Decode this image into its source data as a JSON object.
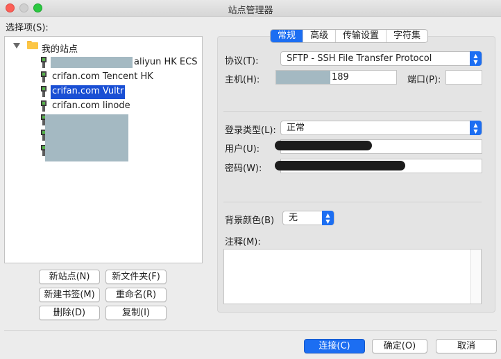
{
  "window": {
    "title": "站点管理器"
  },
  "site_tree": {
    "label": "选择项(S):",
    "root": "我的站点",
    "sites": [
      {
        "label": "aliyun HK ECS"
      },
      {
        "label": "crifan.com Tencent HK"
      },
      {
        "label": "crifan.com Vultr",
        "selected": true
      },
      {
        "label": "crifan.com linode"
      }
    ]
  },
  "left_buttons": {
    "new_site": "新站点(N)",
    "new_folder": "新文件夹(F)",
    "new_bookmark": "新建书签(M)",
    "rename": "重命名(R)",
    "delete": "删除(D)",
    "duplicate": "复制(I)"
  },
  "tabs": [
    {
      "label": "常规",
      "active": true
    },
    {
      "label": "高级"
    },
    {
      "label": "传输设置"
    },
    {
      "label": "字符集"
    }
  ],
  "general": {
    "protocol_label": "协议(T):",
    "protocol_value": "SFTP - SSH File Transfer Protocol",
    "host_label": "主机(H):",
    "host_value": "189",
    "port_label": "端口(P):",
    "port_value": "",
    "logon_type_label": "登录类型(L):",
    "logon_type_value": "正常",
    "user_label": "用户(U):",
    "password_label": "密码(W):",
    "bgcolor_label": "背景颜色(B)",
    "bgcolor_value": "无",
    "comments_label": "注释(M):"
  },
  "footer": {
    "connect": "连接(C)",
    "ok": "确定(O)",
    "cancel": "取消"
  },
  "colors": {
    "accent": "#1c6ef2",
    "selection": "#1a4fd4",
    "redaction": "#a4b9c2"
  }
}
